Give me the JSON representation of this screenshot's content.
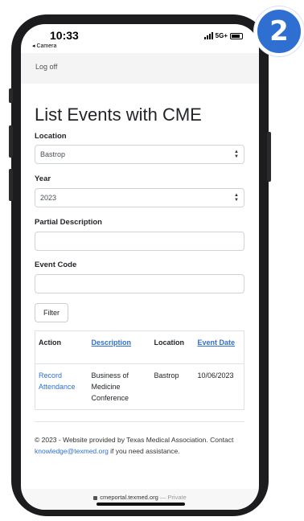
{
  "status_bar": {
    "time": "10:33",
    "back_app": "◂ Camera",
    "network": "5G+"
  },
  "step_badge": "2",
  "nav": {
    "logoff_label": "Log off"
  },
  "page_title": "List Events with CME",
  "form": {
    "location_label": "Location",
    "location_value": "Bastrop",
    "year_label": "Year",
    "year_value": "2023",
    "partial_description_label": "Partial Description",
    "partial_description_value": "",
    "event_code_label": "Event Code",
    "event_code_value": "",
    "filter_label": "Filter"
  },
  "table": {
    "headers": {
      "action": "Action",
      "description": "Description",
      "location": "Location",
      "event_date": "Event Date"
    },
    "rows": [
      {
        "action": "Record Attendance",
        "description": "Business of Medicine Conference",
        "location": "Bastrop",
        "event_date": "10/06/2023"
      }
    ]
  },
  "footer": {
    "text_before": "© 2023 - Website provided by Texas Medical Association. Contact ",
    "email": "knowledge@texmed.org",
    "text_after": " if you need assistance."
  },
  "browser": {
    "url": "cmeportal.texmed.org",
    "privacy": "— Private"
  },
  "colors": {
    "accent": "#2f6fd1",
    "phone_frame": "#1c1c1e"
  }
}
